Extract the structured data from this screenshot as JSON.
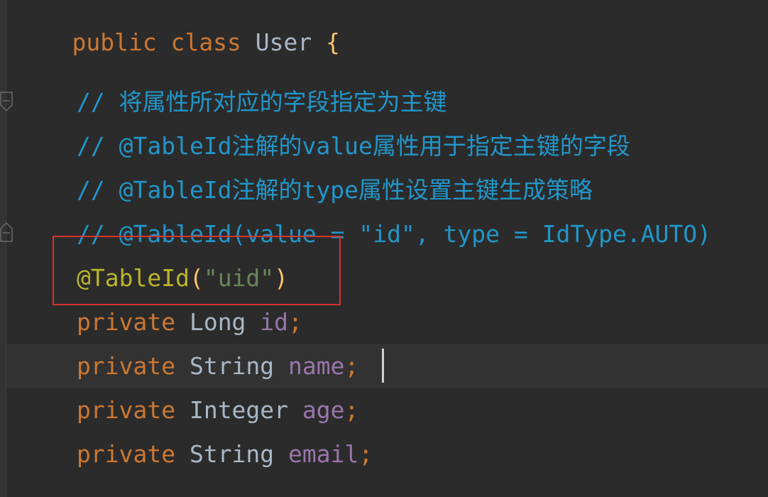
{
  "code": {
    "line1": {
      "kw_public": "public",
      "kw_class": "class",
      "class_name": "User",
      "brace": "{"
    },
    "comments": [
      "// 将属性所对应的字段指定为主键",
      "// @TableId注解的value属性用于指定主键的字段",
      "// @TableId注解的type属性设置主键生成策略",
      "// @TableId(value = \"id\", type = IdType.AUTO)"
    ],
    "annotation": {
      "name": "@TableId",
      "open": "(",
      "value": "\"uid\"",
      "close": ")"
    },
    "fields": [
      {
        "modifier": "private",
        "type": "Long",
        "name": "id",
        "semi": ";"
      },
      {
        "modifier": "private",
        "type": "String",
        "name": "name",
        "semi": ";"
      },
      {
        "modifier": "private",
        "type": "Integer",
        "name": "age",
        "semi": ";"
      },
      {
        "modifier": "private",
        "type": "String",
        "name": "email",
        "semi": ";"
      }
    ]
  },
  "colors": {
    "background": "#2b2b2b",
    "keyword": "#cc7832",
    "comment": "#2196c9",
    "annotation": "#bbb529",
    "string": "#6a8759",
    "field": "#9876aa",
    "highlight_box": "#d6322f"
  }
}
